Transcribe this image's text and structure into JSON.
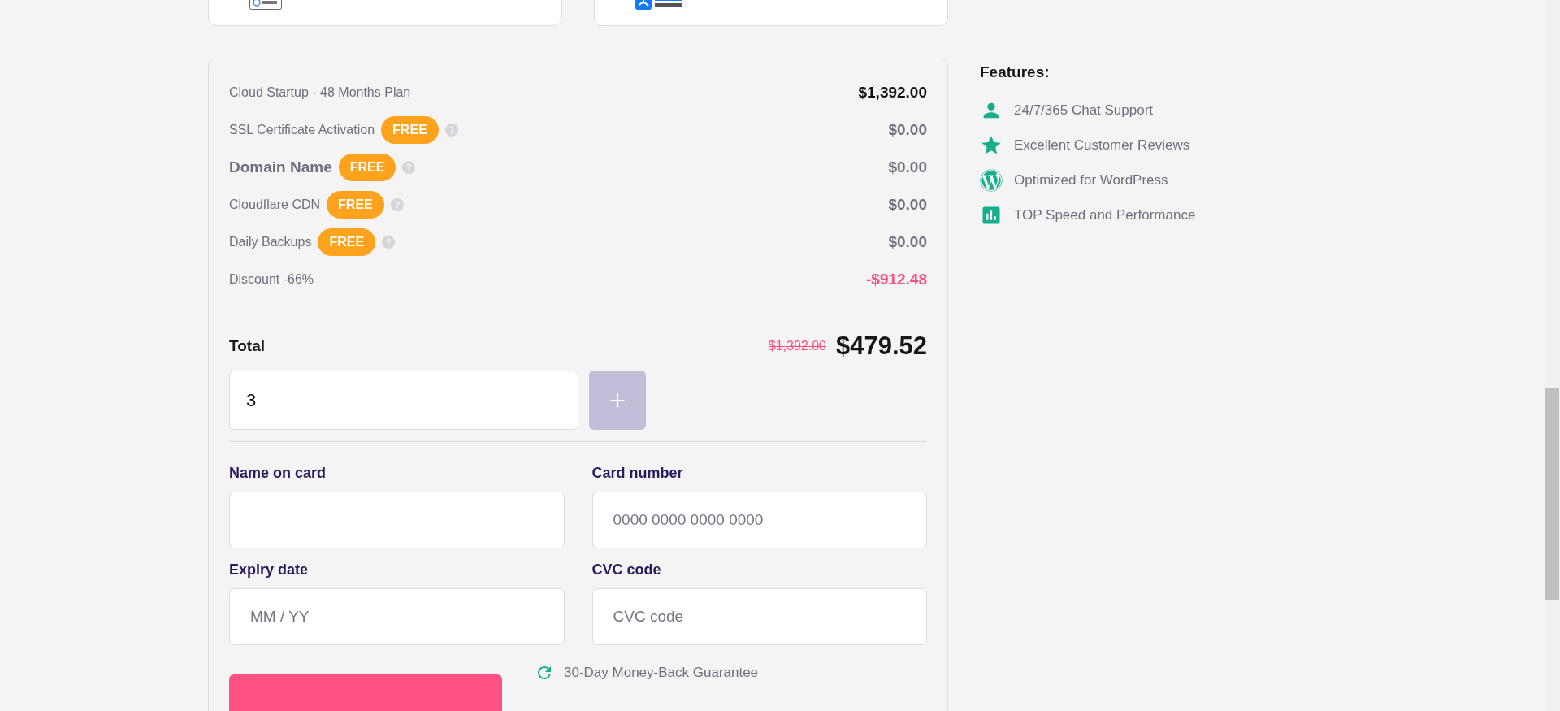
{
  "payment_methods": [
    {
      "kind": "gpay"
    },
    {
      "kind": "alipay"
    }
  ],
  "summary": {
    "lines": [
      {
        "kind": "plan",
        "label": "Cloud Startup - 48 Months Plan",
        "price": "$1,392.00"
      },
      {
        "kind": "free",
        "label": "SSL Certificate Activation",
        "badge": "FREE",
        "price": "$0.00",
        "highlight": false
      },
      {
        "kind": "free",
        "label": "Domain Name",
        "badge": "FREE",
        "price": "$0.00",
        "highlight": true
      },
      {
        "kind": "free",
        "label": "Cloudflare CDN",
        "badge": "FREE",
        "price": "$0.00",
        "highlight": false
      },
      {
        "kind": "free",
        "label": "Daily Backups",
        "badge": "FREE",
        "price": "$0.00",
        "highlight": false
      },
      {
        "kind": "discount",
        "label": "Discount -66%",
        "price": "-$912.48"
      }
    ],
    "total": {
      "label": "Total",
      "old_price": "$1,392.00",
      "price": "$479.52"
    },
    "coupon": {
      "value": "3",
      "add_disabled": true
    }
  },
  "card_form": [
    {
      "label": "Name on card"
    },
    {
      "label": "Card number",
      "placeholder": "0000 0000 0000 0000"
    },
    {
      "label": "Expiry date",
      "placeholder": "MM / YY"
    },
    {
      "label": "CVC code",
      "placeholder": "CVC code"
    }
  ],
  "guarantee": "30-Day Money-Back Guarantee",
  "features": {
    "title": "Features:",
    "items": [
      {
        "kind": "person",
        "text": "24/7/365 Chat Support"
      },
      {
        "kind": "star",
        "text": "Excellent Customer Reviews"
      },
      {
        "kind": "wordpress",
        "text": "Optimized for WordPress"
      },
      {
        "kind": "chart",
        "text": "TOP Speed and Performance"
      }
    ]
  }
}
